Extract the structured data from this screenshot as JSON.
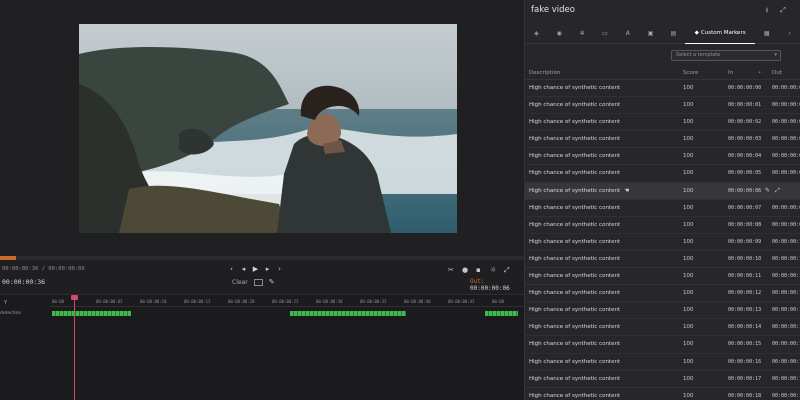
{
  "panel": {
    "title": "fake video",
    "header_icons": [
      "download-icon",
      "fullscreen-icon"
    ],
    "tabs": [
      {
        "name": "shield-icon"
      },
      {
        "name": "face-icon"
      },
      {
        "name": "gear-icon"
      },
      {
        "name": "comment-icon"
      },
      {
        "name": "translate-icon"
      },
      {
        "name": "lock-icon"
      },
      {
        "name": "list-icon"
      },
      {
        "name": "custom-markers-tab",
        "label": "Custom Markers",
        "active": true
      },
      {
        "name": "image-icon"
      },
      {
        "name": "overflow-icon"
      }
    ],
    "select_value": "Select a template",
    "columns": {
      "description": "Description",
      "score": "Score",
      "in": "In",
      "out": "Out"
    },
    "rows": [
      {
        "description": "High chance of synthetic content",
        "score": "100",
        "in": "00:00:00:00",
        "out": "00:00:00:0"
      },
      {
        "description": "High chance of synthetic content",
        "score": "100",
        "in": "00:00:00:01",
        "out": "00:00:00:0"
      },
      {
        "description": "High chance of synthetic content",
        "score": "100",
        "in": "00:00:00:02",
        "out": "00:00:00:0"
      },
      {
        "description": "High chance of synthetic content",
        "score": "100",
        "in": "00:00:00:03",
        "out": "00:00:00:0"
      },
      {
        "description": "High chance of synthetic content",
        "score": "100",
        "in": "00:00:00:04",
        "out": "00:00:00:0"
      },
      {
        "description": "High chance of synthetic content",
        "score": "100",
        "in": "00:00:00:05",
        "out": "00:00:00:0"
      },
      {
        "description": "High chance of synthetic content",
        "score": "100",
        "in": "00:00:00:06",
        "out": "",
        "highlight": true
      },
      {
        "description": "High chance of synthetic content",
        "score": "100",
        "in": "00:00:00:07",
        "out": "00:00:00:0"
      },
      {
        "description": "High chance of synthetic content",
        "score": "100",
        "in": "00:00:00:08",
        "out": "00:00:00:0"
      },
      {
        "description": "High chance of synthetic content",
        "score": "100",
        "in": "00:00:00:09",
        "out": "00:00:00:1"
      },
      {
        "description": "High chance of synthetic content",
        "score": "100",
        "in": "00:00:00:10",
        "out": "00:00:00:1"
      },
      {
        "description": "High chance of synthetic content",
        "score": "100",
        "in": "00:00:00:11",
        "out": "00:00:00:1"
      },
      {
        "description": "High chance of synthetic content",
        "score": "100",
        "in": "00:00:00:12",
        "out": "00:00:00:1"
      },
      {
        "description": "High chance of synthetic content",
        "score": "100",
        "in": "00:00:00:13",
        "out": "00:00:00:1"
      },
      {
        "description": "High chance of synthetic content",
        "score": "100",
        "in": "00:00:00:14",
        "out": "00:00:00:1"
      },
      {
        "description": "High chance of synthetic content",
        "score": "100",
        "in": "00:00:00:15",
        "out": "00:00:00:1"
      },
      {
        "description": "High chance of synthetic content",
        "score": "100",
        "in": "00:00:00:16",
        "out": "00:00:00:1"
      },
      {
        "description": "High chance of synthetic content",
        "score": "100",
        "in": "00:00:00:17",
        "out": "00:00:00:1"
      },
      {
        "description": "High chance of synthetic content",
        "score": "100",
        "in": "00:00:00:18",
        "out": "00:00:00:1"
      }
    ]
  },
  "transport": {
    "time_small": "00:00:00:36 / 00:00:00:06",
    "time_main": "00:00:00:36",
    "clear_label": "Clear",
    "out_label": "Out:",
    "out_value": "00:00:00:06",
    "progress_fraction": 0.03
  },
  "timeline": {
    "header": "Y",
    "track_label": "detection",
    "ticks": [
      "00:00",
      "00:00:00:05",
      "00:00:00:10",
      "00:00:00:15",
      "00:00:00:20",
      "00:00:00:25",
      "00:00:00:30",
      "00:00:00:35",
      "00:00:00:40",
      "00:00:00:45",
      "00:00"
    ],
    "segments": [
      {
        "start": 0.0,
        "end": 0.17
      },
      {
        "start": 0.51,
        "end": 0.76
      },
      {
        "start": 0.93,
        "end": 1.0
      }
    ]
  },
  "colors": {
    "accent": "#c8692e",
    "marker_green": "#3dbb4d",
    "playhead": "#d34a67"
  }
}
